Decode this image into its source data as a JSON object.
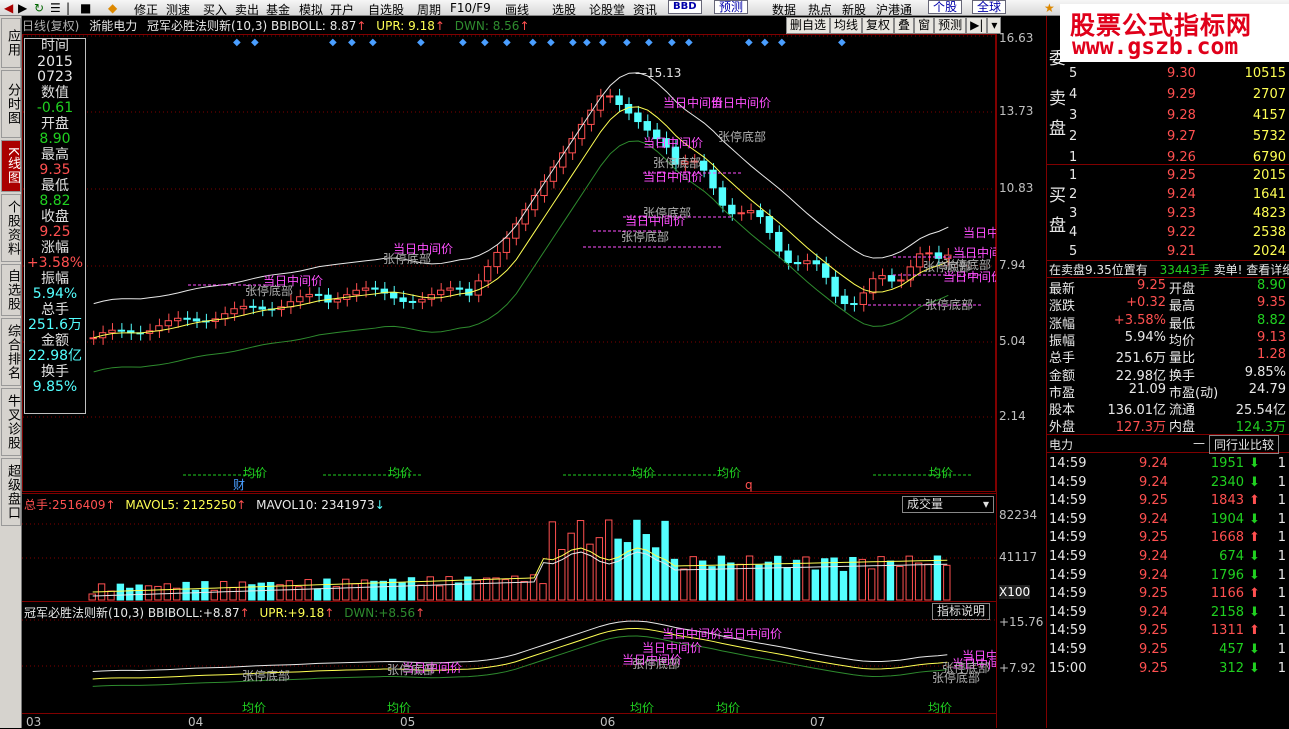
{
  "menu": {
    "items": [
      "修正",
      "测速",
      "买入",
      "卖出",
      "基金",
      "模拟",
      "开户",
      "自选股",
      "周期",
      "画线",
      "选股",
      "论股堂",
      "资讯",
      "BBD",
      "预测",
      "数据",
      "热点",
      "新股",
      "沪港通",
      "个股",
      "全球"
    ]
  },
  "watermark": {
    "line1": "股票公式指标网",
    "line2": "www.gszb.com"
  },
  "lefttabs": [
    "应用",
    "分时图",
    "K线图",
    "个股资料",
    "自选股",
    "综合排名",
    "牛叉诊股",
    "超级盘口"
  ],
  "header": {
    "period": "日线(复权)",
    "stock": "浙能电力",
    "formula": "冠军必胜法则新(10,3)",
    "bbiboll_label": "BBIBOLL:",
    "bbiboll": "8.87",
    "upr_label": "UPR:",
    "upr": "9.18",
    "dwn_label": "DWN:",
    "dwn": "8.56"
  },
  "chart_buttons": [
    "删自选",
    "均线",
    "复权",
    "叠",
    "窗",
    "预测",
    "▶|",
    "▾"
  ],
  "datawin": [
    {
      "k": "时间",
      "v": "2015",
      "c": "wht"
    },
    {
      "k": "",
      "v": "0723",
      "c": "wht"
    },
    {
      "k": "数值",
      "v": "-0.61",
      "c": "grn"
    },
    {
      "k": "开盘",
      "v": "8.90",
      "c": "grn"
    },
    {
      "k": "最高",
      "v": "9.35",
      "c": "red"
    },
    {
      "k": "最低",
      "v": "8.82",
      "c": "grn"
    },
    {
      "k": "收盘",
      "v": "9.25",
      "c": "red"
    },
    {
      "k": "涨幅",
      "v": "+3.58%",
      "c": "red"
    },
    {
      "k": "振幅",
      "v": "5.94%",
      "c": "cyn"
    },
    {
      "k": "总手",
      "v": "251.6万",
      "c": "cyn"
    },
    {
      "k": "金额",
      "v": "22.98亿",
      "c": "cyn"
    },
    {
      "k": "换手",
      "v": "9.85%",
      "c": "cyn"
    }
  ],
  "yaxis_main": [
    "16.63",
    "13.73",
    "10.83",
    "7.94",
    "5.04",
    "2.14"
  ],
  "yaxis_vol": [
    "82234",
    "41117",
    "X100"
  ],
  "yaxis_ind": [
    "+15.76",
    "+7.92"
  ],
  "annotations": {
    "peak": "15.13",
    "mid": "当日中间价",
    "bottom": "张停底部",
    "avg": "均价",
    "cai": "财",
    "q": "q"
  },
  "volume": {
    "zongshou_label": "总手:",
    "zongshou": "2516409",
    "mavol5_label": "MAVOL5:",
    "mavol5": "2125250",
    "mavol10_label": "MAVOL10:",
    "mavol10": "2341973",
    "button": "成交量"
  },
  "indicator": {
    "title": "冠军必胜法则新(10,3)",
    "bbiboll_label": "BBIBOLL:",
    "bbiboll": "+8.87",
    "upr_label": "UPR:",
    "upr": "+9.18",
    "dwn_label": "DWN:",
    "dwn": "+8.56",
    "button": "指标说明"
  },
  "xaxis": [
    "03",
    "04",
    "05",
    "06",
    "07"
  ],
  "orderbook": {
    "sell": [
      {
        "n": "5",
        "p": "9.30",
        "v": "10515"
      },
      {
        "n": "4",
        "p": "9.29",
        "v": "2707"
      },
      {
        "n": "3",
        "p": "9.28",
        "v": "4157"
      },
      {
        "n": "2",
        "p": "9.27",
        "v": "5732"
      },
      {
        "n": "1",
        "p": "9.26",
        "v": "6790"
      }
    ],
    "buy": [
      {
        "n": "1",
        "p": "9.25",
        "v": "2015"
      },
      {
        "n": "2",
        "p": "9.24",
        "v": "1641"
      },
      {
        "n": "3",
        "p": "9.23",
        "v": "4823"
      },
      {
        "n": "4",
        "p": "9.22",
        "v": "2538"
      },
      {
        "n": "5",
        "p": "9.21",
        "v": "2024"
      }
    ],
    "sell_label": "卖盘",
    "buy_label": "买盘",
    "top_char": "委"
  },
  "notice": {
    "text": "在卖盘9.35位置有",
    "qty": "33443手",
    "action": "卖单!",
    "link": "查看详细"
  },
  "quote": [
    [
      "最新",
      "9.25",
      "red",
      "开盘",
      "8.90",
      "grn"
    ],
    [
      "涨跌",
      "+0.32",
      "red",
      "最高",
      "9.35",
      "red"
    ],
    [
      "涨幅",
      "+3.58%",
      "red",
      "最低",
      "8.82",
      "grn"
    ],
    [
      "振幅",
      "5.94%",
      "wht",
      "均价",
      "9.13",
      "red"
    ],
    [
      "总手",
      "251.6万",
      "wht",
      "量比",
      "1.28",
      "red"
    ],
    [
      "金额",
      "22.98亿",
      "wht",
      "换手",
      "9.85%",
      "wht"
    ],
    [
      "市盈",
      "21.09",
      "wht",
      "市盈(动)",
      "24.79",
      "wht"
    ],
    [
      "股本",
      "136.01亿",
      "wht",
      "流通",
      "25.54亿",
      "wht"
    ],
    [
      "外盘",
      "127.3万",
      "red",
      "内盘",
      "124.3万",
      "grn"
    ]
  ],
  "ticks_header": {
    "left": "电力",
    "mid": "—",
    "right": "同行业比较"
  },
  "ticks": [
    [
      "14:59",
      "9.24",
      "1951",
      "dn",
      "1"
    ],
    [
      "14:59",
      "9.24",
      "2340",
      "dn",
      "1"
    ],
    [
      "14:59",
      "9.25",
      "1843",
      "up",
      "1"
    ],
    [
      "14:59",
      "9.24",
      "1904",
      "dn",
      "1"
    ],
    [
      "14:59",
      "9.25",
      "1668",
      "up",
      "1"
    ],
    [
      "14:59",
      "9.24",
      "674",
      "dn",
      "1"
    ],
    [
      "14:59",
      "9.24",
      "1796",
      "dn",
      "1"
    ],
    [
      "14:59",
      "9.25",
      "1166",
      "up",
      "1"
    ],
    [
      "14:59",
      "9.24",
      "2158",
      "dn",
      "1"
    ],
    [
      "14:59",
      "9.25",
      "1311",
      "up",
      "1"
    ],
    [
      "14:59",
      "9.25",
      "457",
      "dn",
      "1"
    ],
    [
      "15:00",
      "9.25",
      "312",
      "dn",
      "1"
    ]
  ],
  "colors": {
    "up": "#ff5050",
    "down": "#54ffff",
    "panel_border": "#800000",
    "ma_white": "#e8e8e8",
    "ma_yellow": "#ffff54",
    "dwn_green": "#2e8b2e",
    "magenta": "#ff50ff"
  }
}
